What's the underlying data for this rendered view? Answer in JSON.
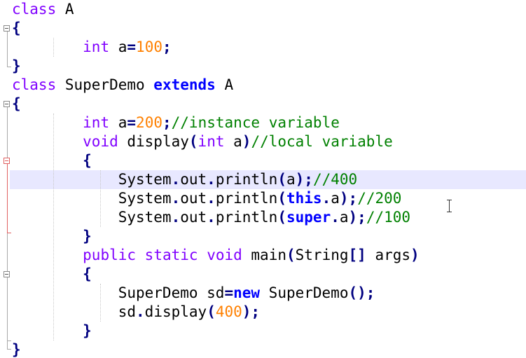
{
  "editor": {
    "colors": {
      "keyword": "#8000ff",
      "bold_keyword": "#0000ff",
      "operator": "#000080",
      "number": "#ff8000",
      "comment": "#008000",
      "current_line": "#e8e8ff",
      "fold_active": "#e06060"
    },
    "lines": [
      {
        "t": [
          {
            "c": "kw",
            "v": "class"
          },
          {
            "c": "id",
            "v": " A"
          }
        ]
      },
      {
        "t": [
          {
            "c": "op",
            "v": "{"
          }
        ]
      },
      {
        "t": [
          {
            "c": "id",
            "v": "        "
          },
          {
            "c": "kw",
            "v": "int"
          },
          {
            "c": "id",
            "v": " a"
          },
          {
            "c": "op",
            "v": "="
          },
          {
            "c": "num",
            "v": "100"
          },
          {
            "c": "op",
            "v": ";"
          }
        ]
      },
      {
        "t": [
          {
            "c": "op",
            "v": "}"
          }
        ]
      },
      {
        "t": [
          {
            "c": "kw",
            "v": "class"
          },
          {
            "c": "id",
            "v": " SuperDemo "
          },
          {
            "c": "bkw",
            "v": "extends"
          },
          {
            "c": "id",
            "v": " A"
          }
        ]
      },
      {
        "t": [
          {
            "c": "op",
            "v": "{"
          }
        ]
      },
      {
        "t": [
          {
            "c": "id",
            "v": "        "
          },
          {
            "c": "kw",
            "v": "int"
          },
          {
            "c": "id",
            "v": " a"
          },
          {
            "c": "op",
            "v": "="
          },
          {
            "c": "num",
            "v": "200"
          },
          {
            "c": "op",
            "v": ";"
          },
          {
            "c": "cm",
            "v": "//instance variable"
          }
        ]
      },
      {
        "t": [
          {
            "c": "id",
            "v": "        "
          },
          {
            "c": "kw",
            "v": "void"
          },
          {
            "c": "id",
            "v": " display"
          },
          {
            "c": "op",
            "v": "("
          },
          {
            "c": "kw",
            "v": "int"
          },
          {
            "c": "id",
            "v": " a"
          },
          {
            "c": "op",
            "v": ")"
          },
          {
            "c": "cm",
            "v": "//local variable"
          }
        ]
      },
      {
        "t": [
          {
            "c": "id",
            "v": "        "
          },
          {
            "c": "op",
            "v": "{"
          }
        ]
      },
      {
        "t": [
          {
            "c": "id",
            "v": "            System"
          },
          {
            "c": "op",
            "v": "."
          },
          {
            "c": "id",
            "v": "out"
          },
          {
            "c": "op",
            "v": "."
          },
          {
            "c": "id",
            "v": "println"
          },
          {
            "c": "op",
            "v": "("
          },
          {
            "c": "id",
            "v": "a"
          },
          {
            "c": "op",
            "v": ");"
          },
          {
            "c": "cm",
            "v": "//400"
          }
        ]
      },
      {
        "t": [
          {
            "c": "id",
            "v": "            System"
          },
          {
            "c": "op",
            "v": "."
          },
          {
            "c": "id",
            "v": "out"
          },
          {
            "c": "op",
            "v": "."
          },
          {
            "c": "id",
            "v": "println"
          },
          {
            "c": "op",
            "v": "("
          },
          {
            "c": "bkw",
            "v": "this"
          },
          {
            "c": "op",
            "v": "."
          },
          {
            "c": "id",
            "v": "a"
          },
          {
            "c": "op",
            "v": ");"
          },
          {
            "c": "cm",
            "v": "//200"
          }
        ]
      },
      {
        "t": [
          {
            "c": "id",
            "v": "            System"
          },
          {
            "c": "op",
            "v": "."
          },
          {
            "c": "id",
            "v": "out"
          },
          {
            "c": "op",
            "v": "."
          },
          {
            "c": "id",
            "v": "println"
          },
          {
            "c": "op",
            "v": "("
          },
          {
            "c": "bkw",
            "v": "super"
          },
          {
            "c": "op",
            "v": "."
          },
          {
            "c": "id",
            "v": "a"
          },
          {
            "c": "op",
            "v": ");"
          },
          {
            "c": "cm",
            "v": "//100"
          }
        ]
      },
      {
        "t": [
          {
            "c": "id",
            "v": "        "
          },
          {
            "c": "op",
            "v": "}"
          }
        ]
      },
      {
        "t": [
          {
            "c": "id",
            "v": "        "
          },
          {
            "c": "kw",
            "v": "public"
          },
          {
            "c": "id",
            "v": " "
          },
          {
            "c": "kw",
            "v": "static"
          },
          {
            "c": "id",
            "v": " "
          },
          {
            "c": "kw",
            "v": "void"
          },
          {
            "c": "id",
            "v": " main"
          },
          {
            "c": "op",
            "v": "("
          },
          {
            "c": "id",
            "v": "String"
          },
          {
            "c": "op",
            "v": "[]"
          },
          {
            "c": "id",
            "v": " args"
          },
          {
            "c": "op",
            "v": ")"
          }
        ]
      },
      {
        "t": [
          {
            "c": "id",
            "v": "        "
          },
          {
            "c": "op",
            "v": "{"
          }
        ]
      },
      {
        "t": [
          {
            "c": "id",
            "v": "            SuperDemo sd"
          },
          {
            "c": "op",
            "v": "="
          },
          {
            "c": "bkw",
            "v": "new"
          },
          {
            "c": "id",
            "v": " SuperDemo"
          },
          {
            "c": "op",
            "v": "();"
          }
        ]
      },
      {
        "t": [
          {
            "c": "id",
            "v": "            sd"
          },
          {
            "c": "op",
            "v": "."
          },
          {
            "c": "id",
            "v": "display"
          },
          {
            "c": "op",
            "v": "("
          },
          {
            "c": "num",
            "v": "400"
          },
          {
            "c": "op",
            "v": ");"
          }
        ]
      },
      {
        "t": [
          {
            "c": "id",
            "v": "        "
          },
          {
            "c": "op",
            "v": "}"
          }
        ]
      },
      {
        "t": [
          {
            "c": "op",
            "v": "}"
          }
        ]
      }
    ]
  }
}
